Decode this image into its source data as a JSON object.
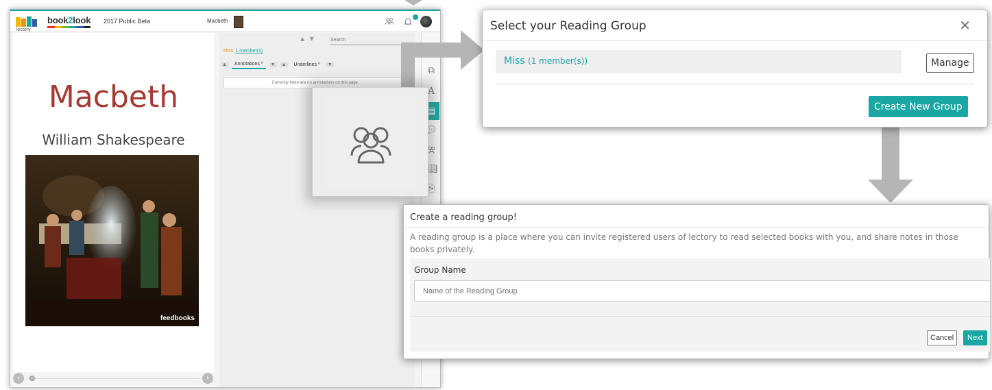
{
  "app": {
    "logo_word": "lectory",
    "brand": {
      "left": "book",
      "mid": "2",
      "right": "look"
    },
    "beta_label": "2017 Public Beta",
    "book_title": "Macbeth",
    "cover": {
      "title": "Macbeth",
      "author": "William Shakespeare",
      "publisher_mark": "feedbooks"
    },
    "search": {
      "placeholder": "Search"
    },
    "group_line": {
      "name": "Miss",
      "members": "1 member(s)"
    },
    "tabs": {
      "annotations": "Annotations ⁰",
      "underlines": "Underlines ⁰"
    },
    "empty_message": "Currently there are no annotations on this page.",
    "accent_color": "#1aa6a3",
    "icons": [
      "group-icon",
      "bell-icon",
      "avatar",
      "layers-icon",
      "font-icon",
      "notes-icon",
      "comment-icon",
      "group-icon",
      "book-icon",
      "export-icon"
    ]
  },
  "select_dialog": {
    "title": "Select your Reading Group",
    "close": "✕",
    "group_name": "Miss",
    "group_members": "(1 member(s))",
    "manage_label": "Manage",
    "create_label": "Create New Group"
  },
  "create_dialog": {
    "title": "Create a reading group!",
    "description": "A reading group is a place where you can invite registered users of lectory to read selected books with you, and share notes in those books privately.",
    "field_label": "Group Name",
    "field_placeholder": "Name of the Reading Group",
    "cancel_label": "Cancel",
    "next_label": "Next"
  }
}
